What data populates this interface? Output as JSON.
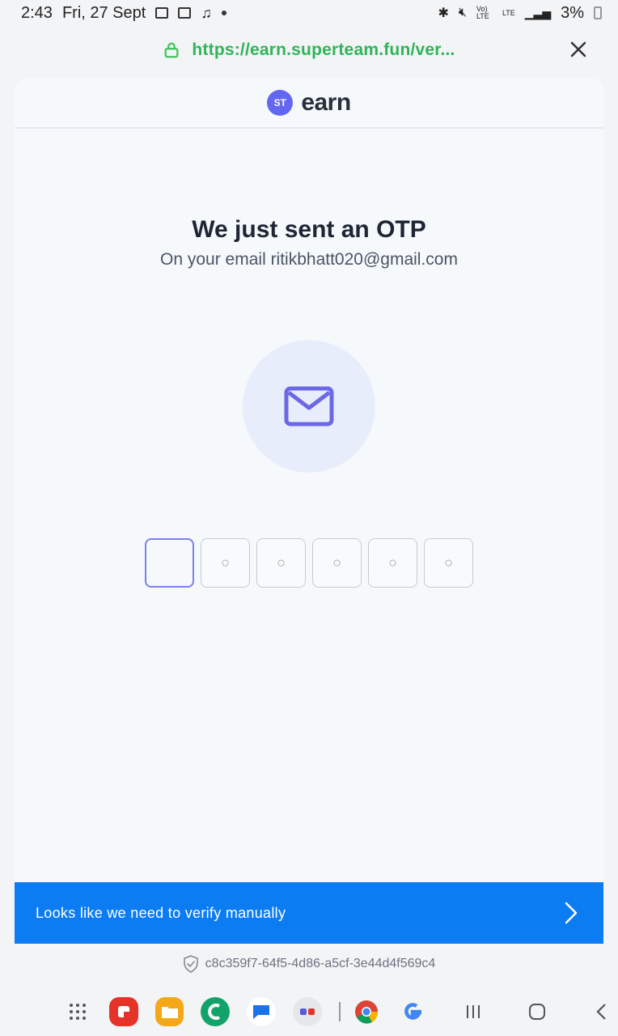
{
  "status_bar": {
    "time": "2:43",
    "date": "Fri, 27 Sept",
    "battery": "3%",
    "network_labels": [
      "Vo) LTE",
      "LTE"
    ]
  },
  "browser": {
    "url": "https://earn.superteam.fun/ver...",
    "url_color": "#2fb459",
    "close_icon": "close-icon"
  },
  "site": {
    "logo_mark": "ST",
    "logo_text": "earn",
    "accent": "#6366f1"
  },
  "otp": {
    "title": "We just sent an OTP",
    "subtitle": "On your email ritikbhatt020@gmail.com",
    "boxes": [
      "",
      "○",
      "○",
      "○",
      "○",
      "○"
    ],
    "icon": "mail-icon"
  },
  "banner": {
    "label": "Looks like we need to verify manually",
    "color": "#0b7cf2",
    "icon": "chevron-right-icon"
  },
  "session": {
    "id": "c8c359f7-64f5-4d86-a5cf-3e44d4f569c4",
    "icon": "shield-check-icon"
  },
  "bottom_nav": {
    "apps": [
      {
        "name": "apps-grid-icon"
      },
      {
        "name": "red-app-icon",
        "color": "#e5332a"
      },
      {
        "name": "files-app-icon",
        "color": "#f4a818"
      },
      {
        "name": "green-app-icon",
        "color": "#12a36a"
      },
      {
        "name": "messages-app-icon",
        "color": "#1a73e8"
      },
      {
        "name": "folder-app-icon",
        "color": "#e5e7eb"
      },
      {
        "name": "chrome-app-icon"
      },
      {
        "name": "google-app-icon"
      }
    ],
    "controls": [
      "recents-icon",
      "home-icon",
      "back-icon"
    ]
  }
}
